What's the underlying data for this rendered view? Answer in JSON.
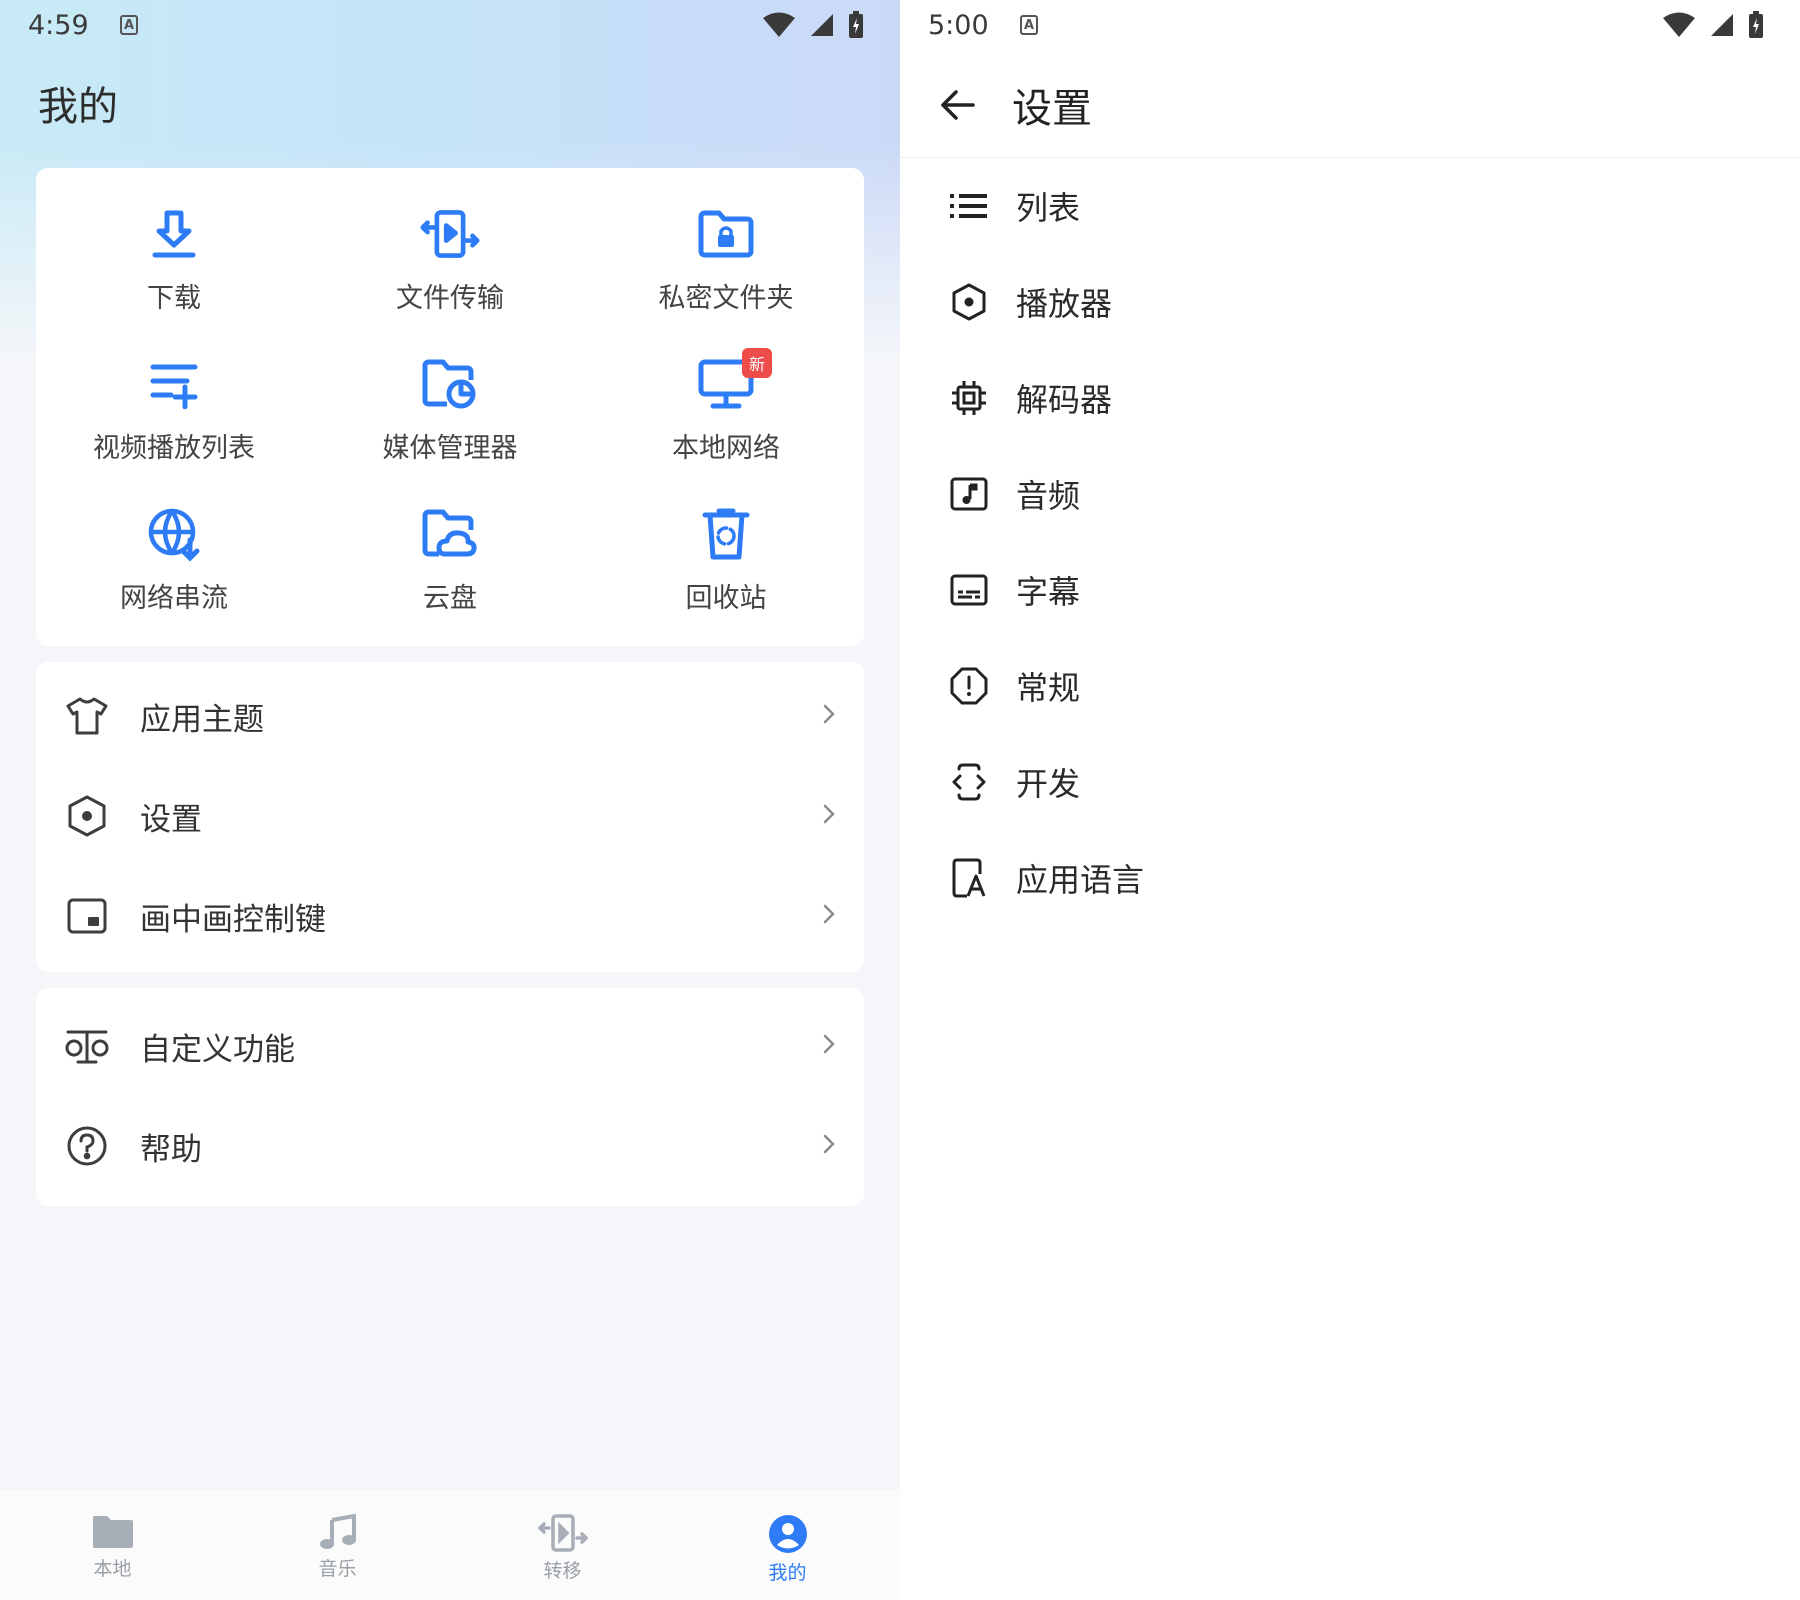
{
  "colors": {
    "accent": "#2d7cf6",
    "badge": "#ee4b4b",
    "icon_gray": "#3d3d3d",
    "nav_gray": "#9aa0a6"
  },
  "left": {
    "status": {
      "time": "4:59",
      "badge_letter": "A"
    },
    "title": "我的",
    "grid": [
      {
        "label": "下载",
        "icon": "download-icon"
      },
      {
        "label": "文件传输",
        "icon": "file-transfer-icon"
      },
      {
        "label": "私密文件夹",
        "icon": "private-folder-icon"
      },
      {
        "label": "视频播放列表",
        "icon": "playlist-add-icon"
      },
      {
        "label": "媒体管理器",
        "icon": "media-manager-icon"
      },
      {
        "label": "本地网络",
        "icon": "local-network-icon",
        "badge": "新"
      },
      {
        "label": "网络串流",
        "icon": "network-stream-icon"
      },
      {
        "label": "云盘",
        "icon": "cloud-folder-icon"
      },
      {
        "label": "回收站",
        "icon": "recycle-bin-icon"
      }
    ],
    "menu1": [
      {
        "label": "应用主题",
        "icon": "tshirt-icon"
      },
      {
        "label": "设置",
        "icon": "settings-hexagon-icon"
      },
      {
        "label": "画中画控制键",
        "icon": "pip-icon"
      }
    ],
    "menu2": [
      {
        "label": "自定义功能",
        "icon": "balance-icon"
      },
      {
        "label": "帮助",
        "icon": "help-icon"
      }
    ],
    "nav": [
      {
        "label": "本地",
        "icon": "folder-icon"
      },
      {
        "label": "音乐",
        "icon": "music-icon"
      },
      {
        "label": "转移",
        "icon": "transfer-icon"
      },
      {
        "label": "我的",
        "icon": "profile-icon",
        "active": true
      }
    ]
  },
  "right": {
    "status": {
      "time": "5:00",
      "badge_letter": "A"
    },
    "title": "设置",
    "items": [
      {
        "label": "列表",
        "icon": "list-icon"
      },
      {
        "label": "播放器",
        "icon": "player-hexagon-icon"
      },
      {
        "label": "解码器",
        "icon": "chip-icon"
      },
      {
        "label": "音频",
        "icon": "audio-icon"
      },
      {
        "label": "字幕",
        "icon": "subtitle-icon"
      },
      {
        "label": "常规",
        "icon": "info-octagon-icon"
      },
      {
        "label": "开发",
        "icon": "developer-icon"
      },
      {
        "label": "应用语言",
        "icon": "language-icon"
      }
    ]
  }
}
